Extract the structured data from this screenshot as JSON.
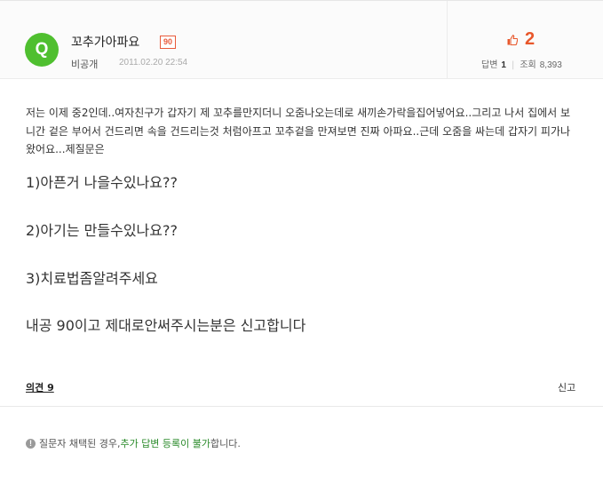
{
  "question": {
    "badge_letter": "Q",
    "title": "꼬추가아파요",
    "points": "90",
    "author": "비공개",
    "date": "2011.02.20 22:54",
    "likes": "2",
    "answers_label": "답변",
    "answers_count": "1",
    "views_label": "조회",
    "views_count": "8,393"
  },
  "body": {
    "paragraph": "저는 이제 중2인데..여자친구가 갑자기 제 꼬추를만지더니 오줌나오는데로 새끼손가락을집어넣어요..그리고 나서 집에서 보니간 겉은 부어서 건드리면 속을 건드리는것 처럼아프고 꼬추겉을 만져보면 진짜 아파요..근데 오줌을 싸는데 갑자기 피가나왔어요...제질문은",
    "q1": "1)아픈거 나을수있나요??",
    "q2": "2)아기는 만들수있나요??",
    "q3": "3)치료법좀알려주세요",
    "q4": "내공 90이고 제대로안써주시는분은 신고합니다"
  },
  "footer": {
    "opinions_label": "의견 9",
    "report_label": "신고",
    "notice_prefix": "질문자 채택된 경우, ",
    "notice_highlight": "추가 답변 등록이 불가",
    "notice_suffix": "합니다."
  },
  "colors": {
    "q_badge": "#4fbf2f",
    "accent_orange": "#e8572b",
    "notice_green": "#2a8a2a"
  },
  "icons": {
    "thumb": "thumbs-up-icon",
    "notice": "info-icon"
  }
}
